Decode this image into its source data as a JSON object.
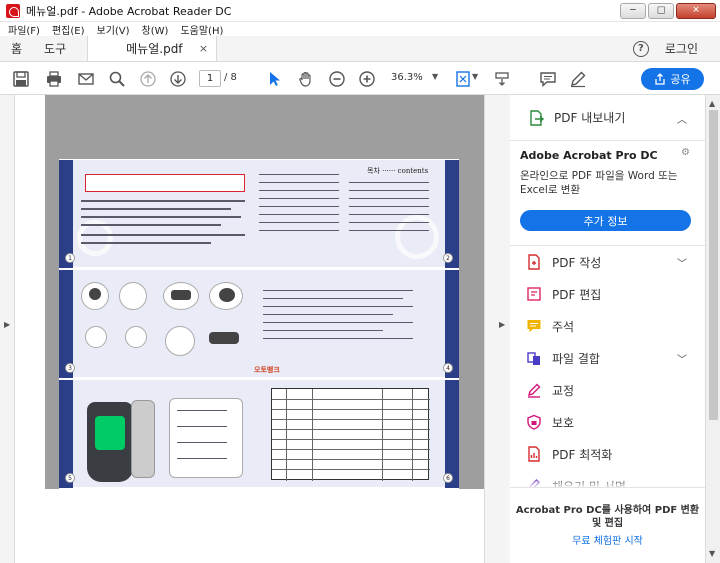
{
  "window": {
    "title": "메뉴얼.pdf - Adobe Acrobat Reader DC",
    "minimize_glyph": "─",
    "maximize_glyph": "□",
    "close_glyph": "✕"
  },
  "menu": [
    "파일(F)",
    "편집(E)",
    "보기(V)",
    "창(W)",
    "도움말(H)"
  ],
  "tabs": {
    "home": "홈",
    "tools": "도구",
    "document": "메뉴얼.pdf",
    "document_close": "×",
    "help": "?",
    "login": "로그인"
  },
  "toolbar": {
    "page_current": "1",
    "page_total": "/ 8",
    "zoom": "36.3%",
    "share_label": "공유"
  },
  "document_page": {
    "toc_title": "목차 ······ contents",
    "brand": "오토뱅크",
    "page_numbers": [
      "1",
      "2",
      "3",
      "4",
      "5",
      "6"
    ]
  },
  "right_panel": {
    "export_label": "PDF 내보내기",
    "product_title": "Adobe Acrobat Pro DC",
    "product_desc": "온라인으로 PDF 파일을 Word 또는 Excel로 변환",
    "more_info": "추가 정보",
    "tools": [
      {
        "label": "PDF 작성",
        "icon": "create-pdf-icon",
        "color": "#d32f2f",
        "expandable": true
      },
      {
        "label": "PDF 편집",
        "icon": "edit-pdf-icon",
        "color": "#e0245e",
        "expandable": false
      },
      {
        "label": "주석",
        "icon": "comment-icon",
        "color": "#f0b400",
        "expandable": false
      },
      {
        "label": "파일 결합",
        "icon": "combine-files-icon",
        "color": "#4b3cc8",
        "expandable": true
      },
      {
        "label": "교정",
        "icon": "redact-icon",
        "color": "#d4147a",
        "expandable": false
      },
      {
        "label": "보호",
        "icon": "protect-icon",
        "color": "#d4147a",
        "expandable": false
      },
      {
        "label": "PDF 최적화",
        "icon": "optimize-pdf-icon",
        "color": "#d32f2f",
        "expandable": false
      },
      {
        "label": "채우기 및 서명",
        "icon": "fill-sign-icon",
        "color": "#7a3cc8",
        "expandable": false
      }
    ],
    "footer_promo": "Acrobat Pro DC를 사용하여 PDF 변환 및 편집",
    "footer_trial": "무료 체험판 시작"
  },
  "colors": {
    "accent": "#1473e6",
    "doc_background": "#9e9e9e",
    "manual_navy": "#2a3f87"
  }
}
